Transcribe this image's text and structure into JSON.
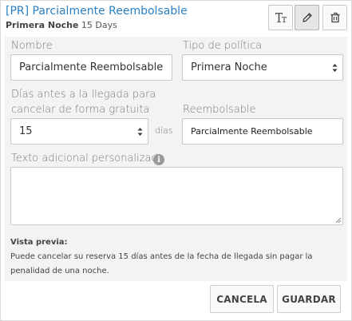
{
  "header": {
    "title": "[PR] Parcialmente Reembolsable",
    "subtitle_bold": "Primera Noche",
    "subtitle_rest": " 15 Days"
  },
  "toolbar": {
    "translate_icon": "text-format-icon",
    "edit_icon": "pencil-icon",
    "delete_icon": "trash-icon"
  },
  "form": {
    "nombre_label": "Nombre",
    "nombre_value": "Parcialmente Reembolsable",
    "tipo_label": "Tipo de política",
    "tipo_value": "Primera Noche",
    "dias_label_line1": "Días antes a la llegada para",
    "dias_label_line2": "cancelar de forma gratuita",
    "dias_value": "15",
    "dias_unit": "días",
    "reembolsable_label": "Reembolsable",
    "reembolsable_value": "Parcialmente Reembolsable",
    "texto_label": "Texto adicional personalizado",
    "texto_value": ""
  },
  "preview": {
    "title": "Vista previa:",
    "line1": "Puede cancelar su reserva 15 días antes de la fecha de llegada sin pagar la",
    "line2": "penalidad de una noche."
  },
  "footer": {
    "cancel_label": "CANCELA",
    "save_label": "GUARDAR"
  },
  "colors": {
    "accent": "#2a7fc3",
    "panel": "#f3f3f3"
  }
}
